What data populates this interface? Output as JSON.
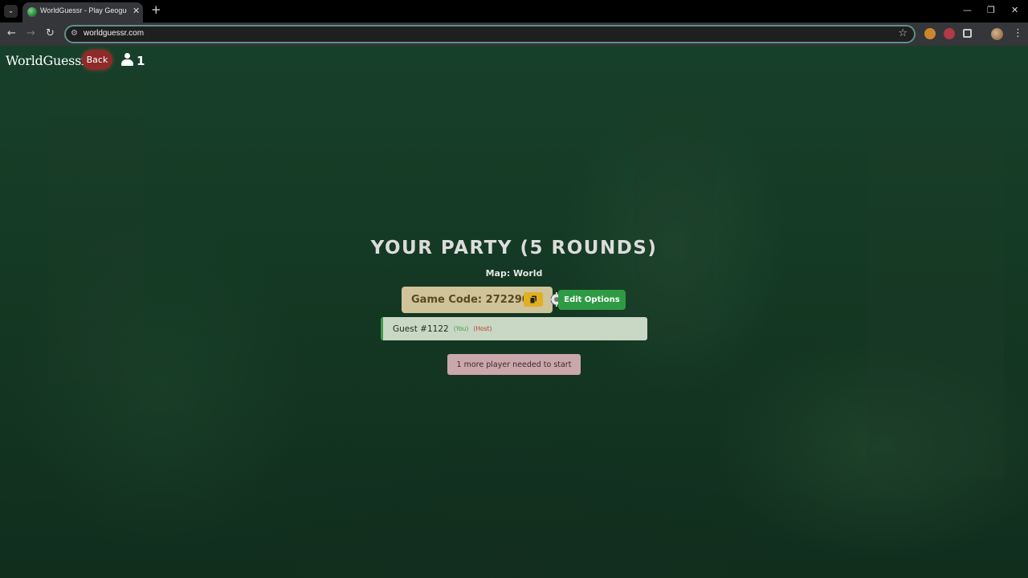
{
  "browser": {
    "tab_title": "WorldGuessr - Play Geoguessr",
    "tab_close": "✕",
    "new_tab": "+",
    "url": "worldguessr.com",
    "window_controls": {
      "minimize": "—",
      "restore": "❐",
      "close": "✕"
    }
  },
  "header": {
    "logo": "WorldGuessr",
    "back_label": "Back",
    "player_count": "1"
  },
  "party": {
    "title": "YOUR PARTY (5 ROUNDS)",
    "map_label": "Map: World",
    "game_code_label": "Game Code: 272290",
    "edit_options_label": "Edit Options"
  },
  "players": [
    {
      "name": "Guest #1122",
      "you_tag": "(You)",
      "host_tag": "(Host)"
    }
  ],
  "status_message": "1 more player needed to start",
  "colors": {
    "back_button": "#8e2a2a",
    "edit_options": "#2e9b44",
    "game_code_bg": "#cfc39a",
    "copy_button": "#e0b020",
    "player_row_bg": "#c9d8c5",
    "status_bg": "#c9a7aa"
  },
  "icons": {
    "copy": "copy-icon",
    "player": "user-icon",
    "cursor": "gear-cursor-icon"
  }
}
